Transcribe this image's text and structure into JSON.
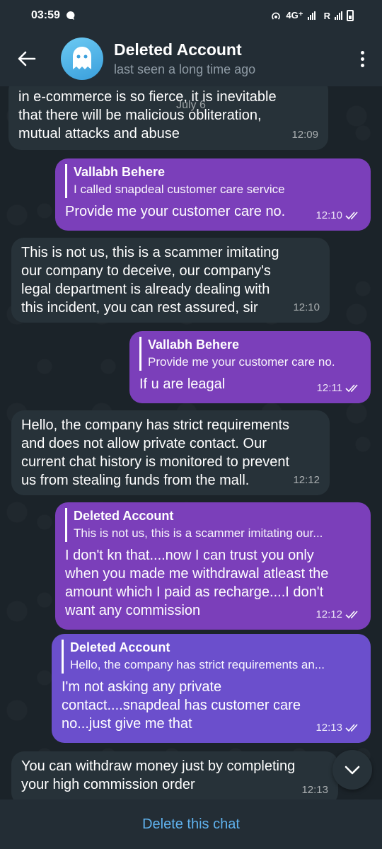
{
  "status_bar": {
    "time": "03:59",
    "network": "4G⁺",
    "roaming": "R"
  },
  "header": {
    "title": "Deleted Account",
    "subtitle": "last seen a long time ago"
  },
  "date_chip": "July 6",
  "messages": [
    {
      "direction": "in",
      "text": "in e-commerce is so fierce, it is inevitable\nthat there will be malicious obliteration,\nmutual attacks and abuse",
      "time": "12:09"
    },
    {
      "direction": "out",
      "reply_name": "Vallabh Behere",
      "reply_text": "I called snapdeal customer care service",
      "text": "Provide me your customer care no.",
      "time": "12:10"
    },
    {
      "direction": "in",
      "text": "This is not us, this is a scammer imitating\nour company to deceive, our company's\nlegal department is already dealing with\nthis incident, you can rest assured, sir",
      "time": "12:10"
    },
    {
      "direction": "out",
      "reply_name": "Vallabh Behere",
      "reply_text": "Provide me your customer care no.",
      "text": "If u are leagal",
      "time": "12:11"
    },
    {
      "direction": "in",
      "text": "Hello, the company has strict requirements\nand does not allow private contact. Our\ncurrent chat history is monitored to prevent\nus from stealing funds from the mall.",
      "time": "12:12"
    },
    {
      "direction": "out",
      "reply_name": "Deleted Account",
      "reply_text": "This is not us, this is a scammer imitating our...",
      "text": "I don't kn that....now I can trust you only\nwhen you made me withdrawal atleast the\namount which I paid as recharge....I don't\nwant any commission",
      "time": "12:12"
    },
    {
      "direction": "out",
      "reply_name": "Deleted Account",
      "reply_text": "Hello, the company has strict requirements an...",
      "text": "I'm not asking any private\ncontact....snapdeal has customer care\nno...just give me that",
      "time": "12:13"
    },
    {
      "direction": "in",
      "text": "You can withdraw money just by completing\nyour high commission order",
      "time": "12:13"
    }
  ],
  "bottom_bar": {
    "delete_label": "Delete this chat"
  },
  "colors": {
    "background": "#1b2329",
    "header": "#232d35",
    "incoming_bubble": "#273239",
    "outgoing_bubble": "#7b3fba",
    "outgoing_bubble_alt": "#6b4fcc",
    "accent_link": "#5fb2ee"
  }
}
